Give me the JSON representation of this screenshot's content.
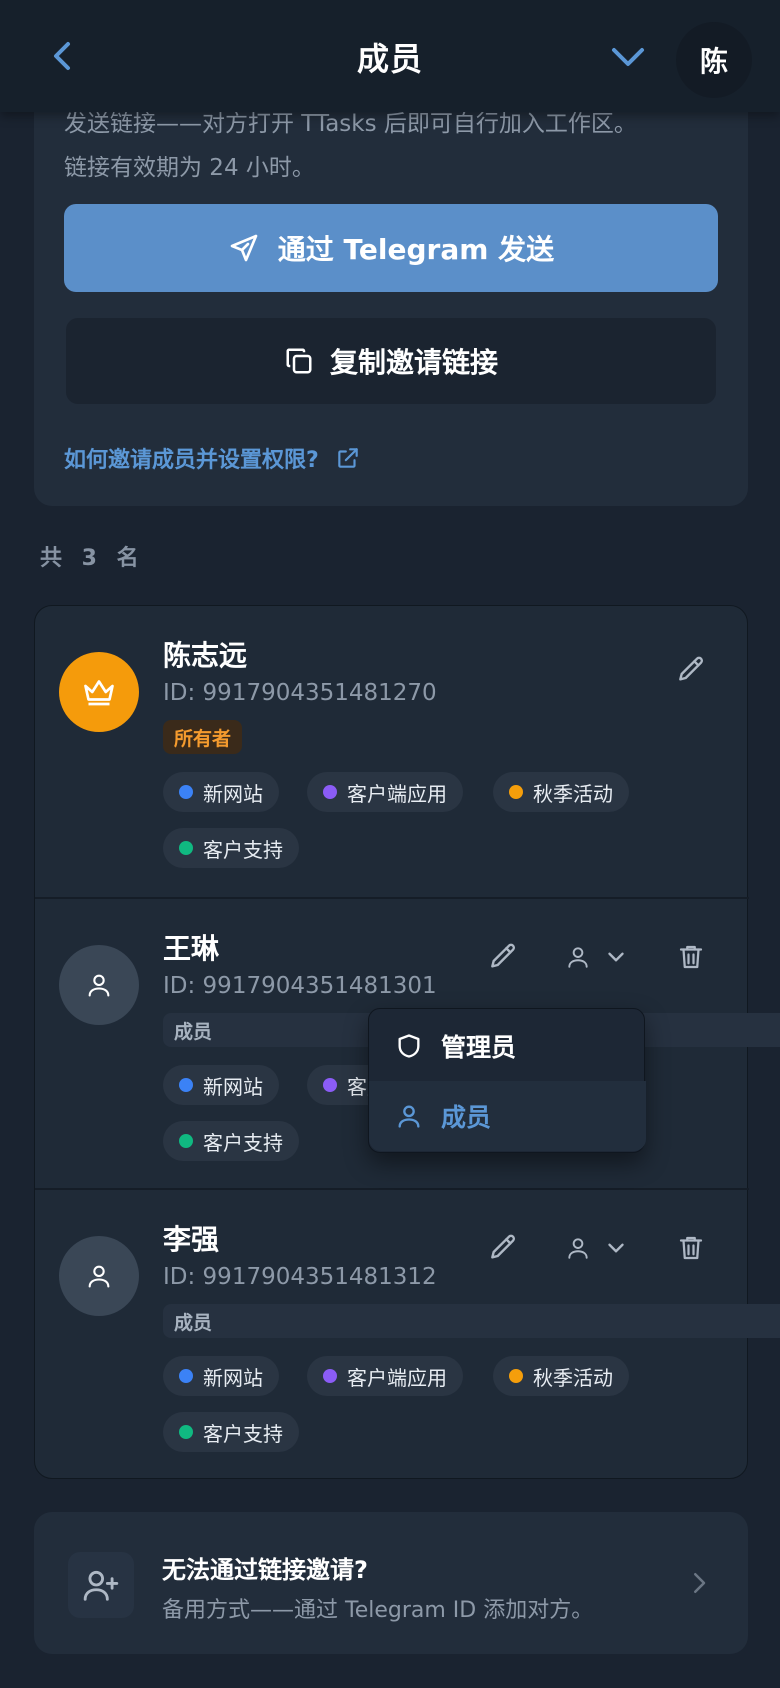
{
  "header": {
    "title": "成员",
    "user_initial": "陈"
  },
  "invite": {
    "description_line1": "发送链接——对方打开 TTasks 后即可自行加入工作区。",
    "description_line2": "链接有效期为 24 小时。",
    "telegram_button": "通过 Telegram 发送",
    "copy_button": "复制邀请链接",
    "help_link": "如何邀请成员并设置权限?"
  },
  "members_count": "共 3 名",
  "members": [
    {
      "name": "陈志远",
      "id": "ID: 9917904351481270",
      "role": "所有者",
      "tags": [
        "新网站",
        "客户端应用",
        "秋季活动",
        "客户支持"
      ]
    },
    {
      "name": "王琳",
      "id": "ID: 9917904351481301",
      "role": "成员",
      "tags": [
        "新网站",
        "客户端应用",
        "客户支持"
      ]
    },
    {
      "name": "李强",
      "id": "ID: 9917904351481312",
      "role": "成员",
      "tags": [
        "新网站",
        "客户端应用",
        "秋季活动",
        "客户支持"
      ]
    }
  ],
  "role_menu": {
    "admin": "管理员",
    "member": "成员"
  },
  "fallback": {
    "title": "无法通过链接邀请?",
    "subtitle": "备用方式——通过 Telegram ID 添加对方。"
  },
  "colors": {
    "accent": "#5b8fc9",
    "link": "#5b97d6",
    "owner": "#f59b0b",
    "tag_blue": "#3b82f6",
    "tag_purple": "#8b5cf6",
    "tag_orange": "#f59e0b",
    "tag_green": "#10b981"
  }
}
